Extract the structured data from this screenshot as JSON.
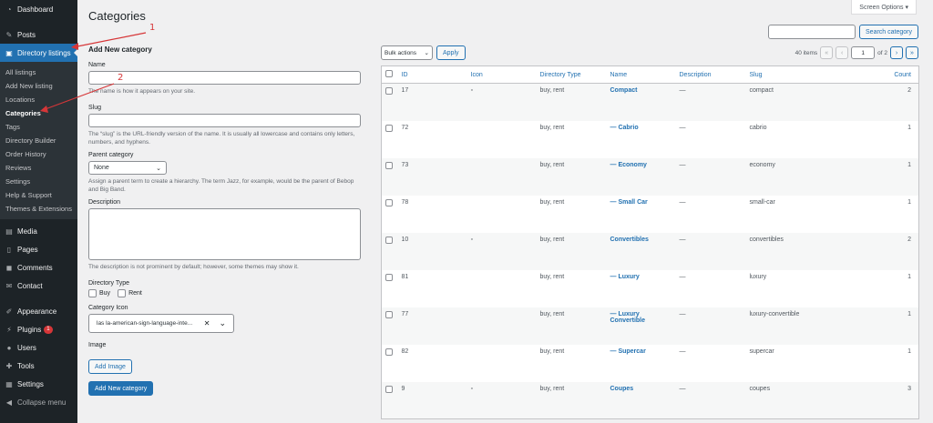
{
  "sidebar": {
    "dashboard": "Dashboard",
    "posts": "Posts",
    "directory_listings": "Directory listings",
    "submenu": [
      "All listings",
      "Add New listing",
      "Locations",
      "Categories",
      "Tags",
      "Directory Builder",
      "Order History",
      "Reviews",
      "Settings",
      "Help & Support",
      "Themes & Extensions"
    ],
    "media": "Media",
    "pages": "Pages",
    "comments": "Comments",
    "contact": "Contact",
    "appearance": "Appearance",
    "plugins": "Plugins",
    "plugins_badge": "1",
    "users": "Users",
    "tools": "Tools",
    "settings": "Settings",
    "collapse": "Collapse menu"
  },
  "header": {
    "title": "Categories",
    "screen_options": "Screen Options ▾"
  },
  "form": {
    "heading": "Add New category",
    "name_label": "Name",
    "name_hint": "The name is how it appears on your site.",
    "slug_label": "Slug",
    "slug_hint": "The “slug” is the URL-friendly version of the name. It is usually all lowercase and contains only letters, numbers, and hyphens.",
    "parent_label": "Parent category",
    "parent_value": "None",
    "parent_hint": "Assign a parent term to create a hierarchy. The term Jazz, for example, would be the parent of Bebop and Big Band.",
    "description_label": "Description",
    "description_hint": "The description is not prominent by default; however, some themes may show it.",
    "directory_type_label": "Directory Type",
    "buy": "Buy",
    "rent": "Rent",
    "category_icon_label": "Category Icon",
    "category_icon_value": "las la-american-sign-language-inte...",
    "image_label": "Image",
    "add_image": "Add Image",
    "submit": "Add New category"
  },
  "list": {
    "search_button": "Search category",
    "bulk_actions": "Bulk actions",
    "apply": "Apply",
    "items_count": "40 items",
    "current_page": "1",
    "of_pages": "of 2",
    "columns": [
      "ID",
      "Icon",
      "Directory Type",
      "Name",
      "Description",
      "Slug",
      "Count"
    ],
    "rows": [
      {
        "id": "17",
        "icon": "▫",
        "type": "buy, rent",
        "name": "Compact",
        "name2": "",
        "desc": "—",
        "slug": "compact",
        "count": "2"
      },
      {
        "id": "72",
        "icon": "",
        "type": "buy, rent",
        "name": "— Cabrio",
        "name2": "",
        "desc": "—",
        "slug": "cabrio",
        "count": "1"
      },
      {
        "id": "73",
        "icon": "",
        "type": "buy, rent",
        "name": "— Economy",
        "name2": "",
        "desc": "—",
        "slug": "economy",
        "count": "1"
      },
      {
        "id": "78",
        "icon": "",
        "type": "buy, rent",
        "name": "— Small Car",
        "name2": "",
        "desc": "—",
        "slug": "small-car",
        "count": "1"
      },
      {
        "id": "10",
        "icon": "▫",
        "type": "buy, rent",
        "name": "Convertibles",
        "name2": "",
        "desc": "—",
        "slug": "convertibles",
        "count": "2"
      },
      {
        "id": "81",
        "icon": "",
        "type": "buy, rent",
        "name": "— Luxury",
        "name2": "",
        "desc": "—",
        "slug": "luxury",
        "count": "1"
      },
      {
        "id": "77",
        "icon": "",
        "type": "buy, rent",
        "name": "— Luxury",
        "name2": "Convertible",
        "desc": "—",
        "slug": "luxury-convertible",
        "count": "1"
      },
      {
        "id": "82",
        "icon": "",
        "type": "buy, rent",
        "name": "— Supercar",
        "name2": "",
        "desc": "—",
        "slug": "supercar",
        "count": "1"
      },
      {
        "id": "9",
        "icon": "▫",
        "type": "buy, rent",
        "name": "Coupes",
        "name2": "",
        "desc": "—",
        "slug": "coupes",
        "count": "3"
      }
    ]
  },
  "annotations": {
    "one": "1",
    "two": "2",
    "color": "#d63638"
  }
}
